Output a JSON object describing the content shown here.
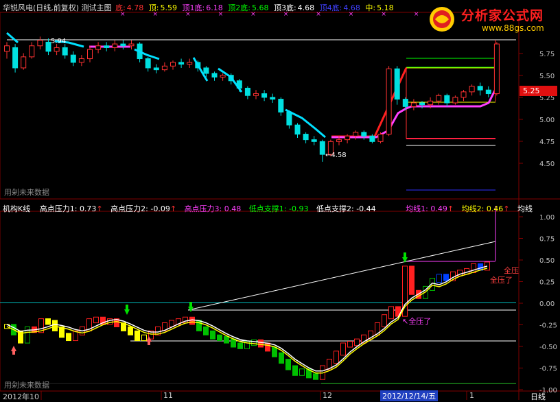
{
  "header": {
    "title": "华锐风电(日线,前复权) 测试主图",
    "items": [
      {
        "label": "底:",
        "value": "4.78",
        "color": "#ff3030"
      },
      {
        "label": "顶:",
        "value": "5.59",
        "color": "#ffff00"
      },
      {
        "label": "顶1底:",
        "value": "6.18",
        "color": "#ff40ff"
      },
      {
        "label": "顶2底:",
        "value": "5.68",
        "color": "#00ff00"
      },
      {
        "label": "顶3底:",
        "value": "4.68",
        "color": "#ffffff"
      },
      {
        "label": "顶4底:",
        "value": "4.68",
        "color": "#4040ff"
      },
      {
        "label": "中:",
        "value": "5.18",
        "color": "#ffff00"
      }
    ]
  },
  "logo": {
    "brand": "分析家公式网",
    "url": "www.88gs.com"
  },
  "main_panel": {
    "watermark": "用剁未来数据",
    "high_label": "5.94",
    "low_label": "4.58",
    "current_price": "5.25",
    "y_ticks": [
      "5.75",
      "5.50",
      "5.25",
      "5.00",
      "4.75",
      "4.50"
    ]
  },
  "indicator_panel": {
    "title": "机构K线",
    "items": [
      {
        "label": "高点压力1:",
        "value": "0.73",
        "color": "#ffffff",
        "arrow": "↑"
      },
      {
        "label": "高点压力2:",
        "value": "-0.09",
        "color": "#ffffff",
        "arrow": "↑"
      },
      {
        "label": "高点压力3:",
        "value": "0.48",
        "color": "#ff40ff",
        "arrow": ""
      },
      {
        "label": "低点支撑1:",
        "value": "-0.93",
        "color": "#00ff00",
        "arrow": ""
      },
      {
        "label": "低点支撑2:",
        "value": "-0.44",
        "color": "#ffffff",
        "arrow": ""
      },
      {
        "label": "均线1:",
        "value": "0.49",
        "color": "#ff40ff",
        "arrow": "↑"
      },
      {
        "label": "均线2:",
        "value": "0.46",
        "color": "#ffff00",
        "arrow": "↑"
      },
      {
        "label": "均线",
        "value": "",
        "color": "#ffffff",
        "arrow": ""
      }
    ],
    "annotations": [
      "全压",
      "全压了",
      "全压了"
    ],
    "watermark": "用剁未来数据",
    "y_ticks": [
      "1.00",
      "0.75",
      "0.50",
      "0.25",
      "0.00",
      "-0.25",
      "-0.50",
      "-0.75",
      "-1.00"
    ]
  },
  "time_axis": {
    "labels": [
      "2012年10",
      "11",
      "12",
      "2012/12/14/五",
      "1"
    ],
    "period": "日线"
  },
  "colors": {
    "up": "#ff3232",
    "down": "#00e0e0",
    "indicator_up": "#ff2020",
    "indicator_down": "#00c000"
  },
  "chart_data": {
    "type": "candlestick",
    "ylim": [
      4.4,
      5.95
    ],
    "candles": [
      [
        5.78,
        5.84,
        5.7,
        5.88
      ],
      [
        5.82,
        5.6,
        5.55,
        5.86
      ],
      [
        5.6,
        5.72,
        5.58,
        5.76
      ],
      [
        5.72,
        5.84,
        5.7,
        5.88
      ],
      [
        5.84,
        5.9,
        5.8,
        5.94
      ],
      [
        5.88,
        5.78,
        5.74,
        5.92
      ],
      [
        5.78,
        5.82,
        5.74,
        5.86
      ],
      [
        5.82,
        5.74,
        5.7,
        5.86
      ],
      [
        5.74,
        5.66,
        5.62,
        5.78
      ],
      [
        5.66,
        5.7,
        5.62,
        5.74
      ],
      [
        5.7,
        5.8,
        5.66,
        5.84
      ],
      [
        5.8,
        5.84,
        5.76,
        5.88
      ],
      [
        5.84,
        5.82,
        5.78,
        5.88
      ],
      [
        5.82,
        5.86,
        5.78,
        5.9
      ],
      [
        5.86,
        5.84,
        5.8,
        5.9
      ],
      [
        5.84,
        5.86,
        5.8,
        5.9
      ],
      [
        5.86,
        5.7,
        5.66,
        5.88
      ],
      [
        5.7,
        5.6,
        5.56,
        5.72
      ],
      [
        5.6,
        5.58,
        5.54,
        5.64
      ],
      [
        5.58,
        5.62,
        5.56,
        5.66
      ],
      [
        5.62,
        5.66,
        5.58,
        5.68
      ],
      [
        5.66,
        5.64,
        5.6,
        5.7
      ],
      [
        5.64,
        5.66,
        5.6,
        5.7
      ],
      [
        5.66,
        5.6,
        5.56,
        5.68
      ],
      [
        5.6,
        5.54,
        5.5,
        5.62
      ],
      [
        5.54,
        5.5,
        5.46,
        5.56
      ],
      [
        5.5,
        5.52,
        5.46,
        5.54
      ],
      [
        5.52,
        5.46,
        5.42,
        5.54
      ],
      [
        5.46,
        5.38,
        5.34,
        5.48
      ],
      [
        5.38,
        5.3,
        5.26,
        5.4
      ],
      [
        5.3,
        5.32,
        5.26,
        5.36
      ],
      [
        5.32,
        5.28,
        5.24,
        5.36
      ],
      [
        5.28,
        5.26,
        5.22,
        5.32
      ],
      [
        5.26,
        5.12,
        5.08,
        5.28
      ],
      [
        5.12,
        4.98,
        4.94,
        5.14
      ],
      [
        4.98,
        4.88,
        4.84,
        5.0
      ],
      [
        4.88,
        4.82,
        4.78,
        4.9
      ],
      [
        4.82,
        4.8,
        4.76,
        4.86
      ],
      [
        4.8,
        4.66,
        4.58,
        4.82
      ],
      [
        4.66,
        4.8,
        4.64,
        4.82
      ],
      [
        4.8,
        4.82,
        4.76,
        4.86
      ],
      [
        4.82,
        4.86,
        4.78,
        4.88
      ],
      [
        4.86,
        4.9,
        4.82,
        4.92
      ],
      [
        4.9,
        4.86,
        4.82,
        4.92
      ],
      [
        4.86,
        4.8,
        4.78,
        4.88
      ],
      [
        4.8,
        4.88,
        4.78,
        4.9
      ],
      [
        4.88,
        5.59,
        4.86,
        5.62
      ],
      [
        5.59,
        5.26,
        5.2,
        5.62
      ],
      [
        5.26,
        5.18,
        5.14,
        5.28
      ],
      [
        5.18,
        5.22,
        5.14,
        5.26
      ],
      [
        5.22,
        5.2,
        5.16,
        5.24
      ],
      [
        5.2,
        5.24,
        5.16,
        5.28
      ],
      [
        5.24,
        5.3,
        5.2,
        5.32
      ],
      [
        5.3,
        5.22,
        5.18,
        5.32
      ],
      [
        5.22,
        5.28,
        5.2,
        5.3
      ],
      [
        5.28,
        5.34,
        5.24,
        5.36
      ],
      [
        5.34,
        5.4,
        5.3,
        5.42
      ],
      [
        5.4,
        5.36,
        5.3,
        5.44
      ],
      [
        5.36,
        5.32,
        5.28,
        5.4
      ],
      [
        5.32,
        5.86,
        5.3,
        5.88
      ]
    ]
  }
}
